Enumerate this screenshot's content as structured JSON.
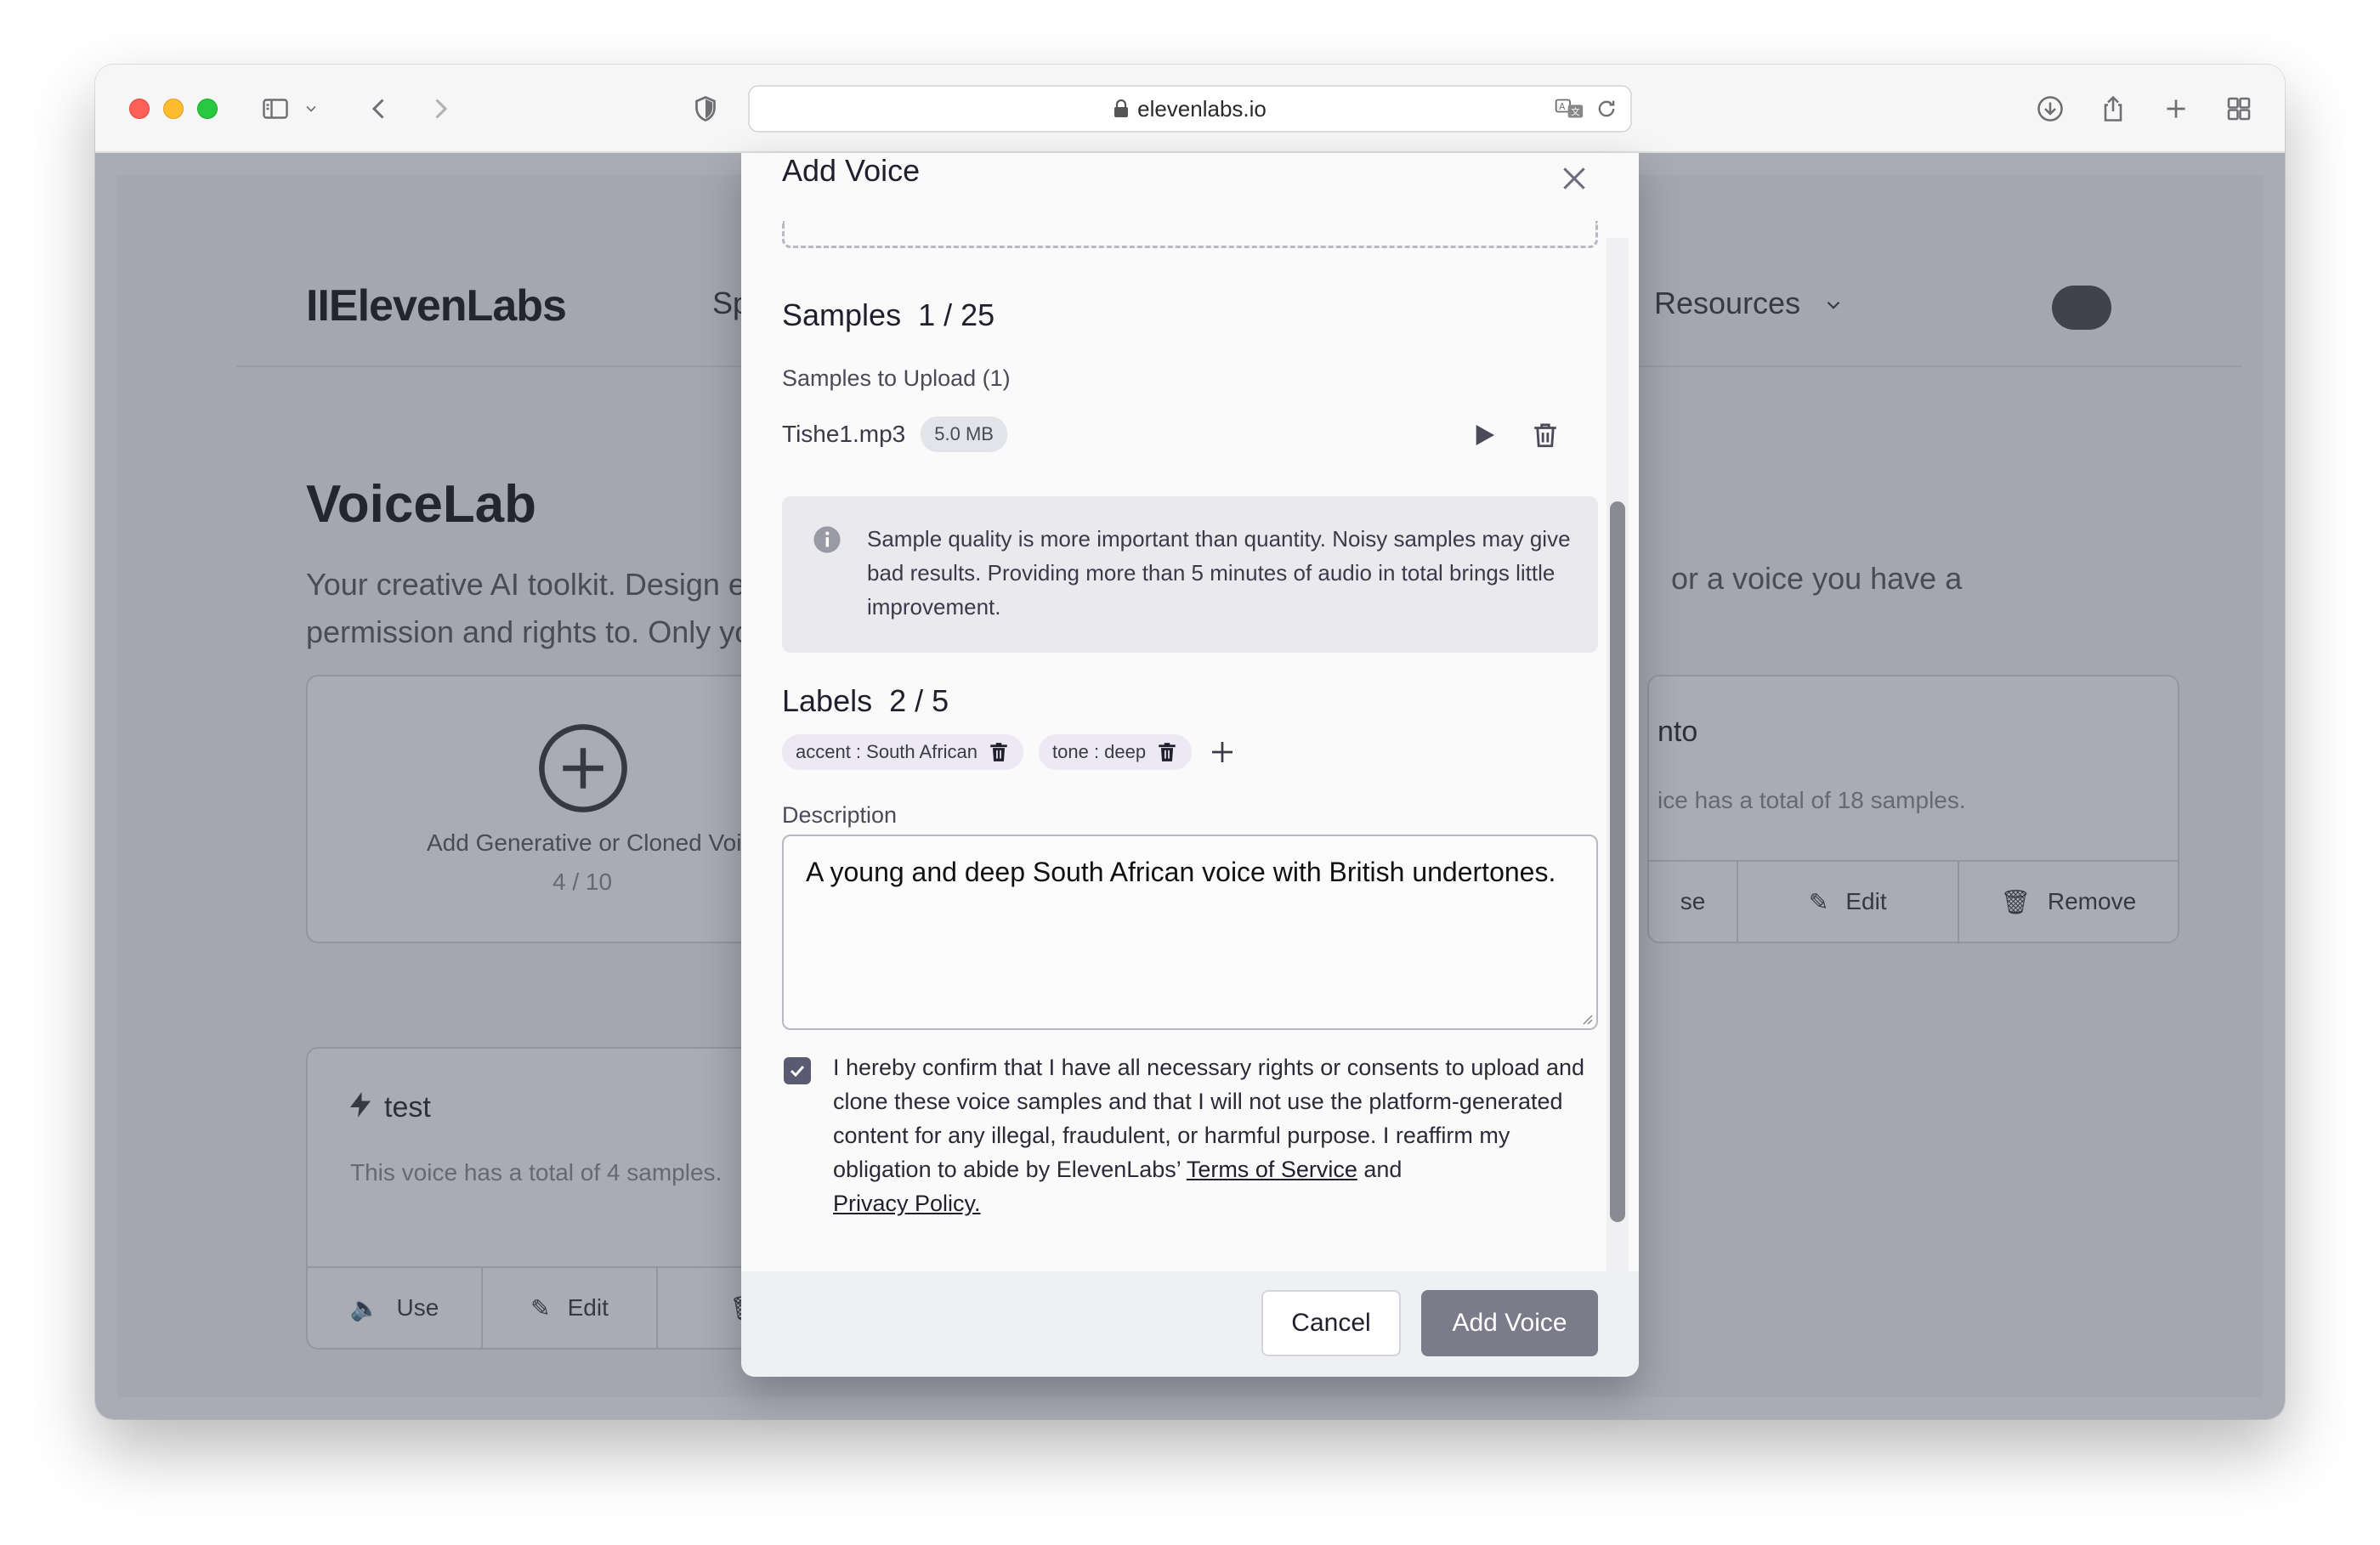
{
  "browser": {
    "url": "elevenlabs.io"
  },
  "background_page": {
    "logo": "IIElevenLabs",
    "nav_partial": "Sp",
    "nav_resources": "Resources",
    "title": "VoiceLab",
    "subtitle_left": "Your creative AI toolkit. Design e",
    "subtitle_left_line2": "permission and rights to. Only yo",
    "subtitle_right": "or a voice you have a",
    "add_card": {
      "label": "Add Generative or Cloned Voice",
      "count": "4 / 10"
    },
    "test_card": {
      "title": "test",
      "desc": "This voice has a total of 4 samples.",
      "use": "Use",
      "edit": "Edit"
    },
    "right_card": {
      "title_partial": "nto",
      "desc_partial": "ice has a total of 18 samples.",
      "use_partial": "se",
      "edit": "Edit",
      "remove": "Remove"
    }
  },
  "modal": {
    "title": "Add Voice",
    "samples_heading": "Samples",
    "samples_count": "1 / 25",
    "samples_to_upload": "Samples to Upload (1)",
    "files": [
      {
        "name": "Tishe1.mp3",
        "size": "5.0 MB"
      }
    ],
    "info_text": "Sample quality is more important than quantity. Noisy samples may give bad results. Providing more than 5 minutes of audio in total brings little improvement.",
    "labels_heading": "Labels",
    "labels_count": "2 / 5",
    "labels": [
      {
        "text": "accent : South African"
      },
      {
        "text": "tone : deep"
      }
    ],
    "description_label": "Description",
    "description_value": "A young and deep South African voice with British undertones.",
    "consent_checked": true,
    "consent_text": "I hereby confirm that I have all necessary rights or consents to upload and clone these voice samples and that I will not use the platform-generated content for any illegal, fraudulent, or harmful purpose. I reaffirm my obligation to abide by ElevenLabs’ ",
    "terms_link": "Terms of Service",
    "consent_and": " and",
    "privacy_link": "Privacy Policy.",
    "cancel_label": "Cancel",
    "add_label": "Add Voice"
  }
}
